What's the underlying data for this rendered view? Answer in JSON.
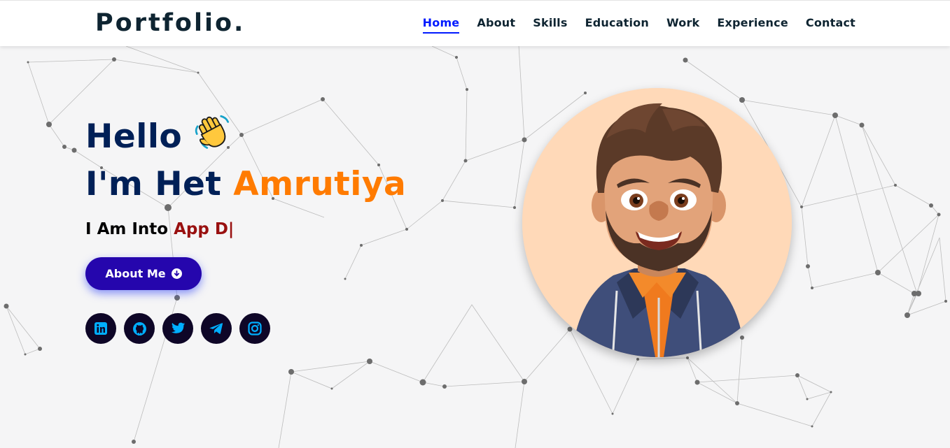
{
  "header": {
    "logo": "Portfolio.",
    "nav": [
      "Home",
      "About",
      "Skills",
      "Education",
      "Work",
      "Experience",
      "Contact"
    ],
    "active_nav": "Home"
  },
  "hero": {
    "greeting": "Hello",
    "greeting_icon": "waving-hand-icon",
    "intro_prefix": "I'm Het",
    "intro_accent": "Amrutiya",
    "typing_prefix": "I Am Into",
    "typing_text": "App D|",
    "about_button": "About Me",
    "about_button_icon": "arrow-down-circle-icon",
    "avatar": "profile-avatar"
  },
  "socials": [
    {
      "icon": "linkedin-icon"
    },
    {
      "icon": "github-icon"
    },
    {
      "icon": "twitter-icon"
    },
    {
      "icon": "telegram-icon"
    },
    {
      "icon": "instagram-icon"
    }
  ],
  "colors": {
    "nav_text": "#0e2431",
    "nav_active": "#011aff",
    "heading": "#002057",
    "accent": "#ff7b00",
    "typed": "#991010",
    "button": "#2506ad",
    "social_bg": "#0e0627",
    "social_icon": "#00aeff"
  }
}
